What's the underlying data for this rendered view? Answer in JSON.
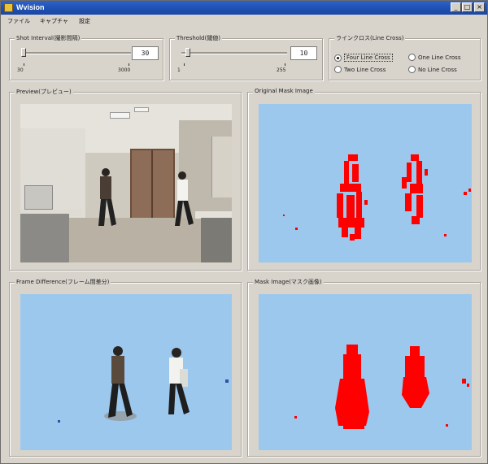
{
  "window": {
    "title": "Wvision",
    "controls": [
      "_",
      "□",
      "×"
    ]
  },
  "menu": [
    "ファイル",
    "キャプチャ",
    "設定"
  ],
  "shot_interval": {
    "label": "Shot Interval(撮影間隔)",
    "value": "30",
    "min_label": "30",
    "max_label": "3000",
    "level_fraction": 0.0
  },
  "threshold": {
    "label": "Threshold(閾値)",
    "value": "10",
    "min_label": "1",
    "max_label": "255",
    "level_fraction": 0.04
  },
  "line_cross": {
    "label": "ラインクロス(Line Cross)",
    "options": [
      {
        "label": "Four Line Cross",
        "selected": true
      },
      {
        "label": "One Line Cross",
        "selected": false
      },
      {
        "label": "Two Line Cross",
        "selected": false
      },
      {
        "label": "No Line Cross",
        "selected": false
      }
    ]
  },
  "panels": {
    "preview": "Preview(プレビュー)",
    "original_mask": "Original Mask Image",
    "frame_difference": "Frame Difference(フレーム間差分)",
    "mask_image": "Mask Image(マスク画像)"
  },
  "colors": {
    "mask_background": "#9cc8ee",
    "mask_foreground": "#ff0000",
    "window_face": "#d8d4cc",
    "title_bar": "#1e4fb0"
  }
}
